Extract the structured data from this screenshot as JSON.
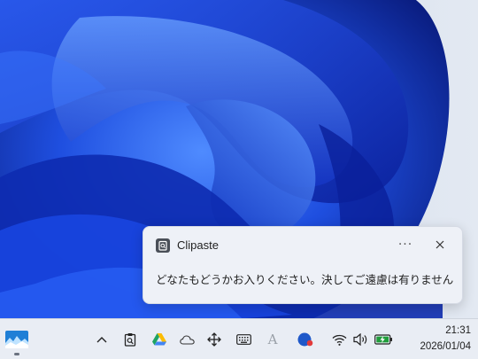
{
  "notification": {
    "app_name": "Clipaste",
    "message": "どなたもどうかお入りください。決してご遠慮は有りません",
    "more_label": "···"
  },
  "taskbar": {
    "start_icon": "landscape-app-icon",
    "tray_icons": [
      "chevron-up-icon",
      "clipboard-search-icon",
      "google-drive-icon",
      "cloud-icon",
      "move-icon",
      "keyboard-icon",
      "ime-icon",
      "blue-circle-app-icon",
      "wifi-icon",
      "volume-icon",
      "battery-charging-icon"
    ],
    "ime_label": "A",
    "time": "21:31",
    "date": "2026/01/04"
  },
  "colors": {
    "wallpaper_dark": "#0b1e8c",
    "wallpaper_bright": "#2f6bff",
    "taskbar_bg": "#e9edf4",
    "toast_bg": "#eef1f7",
    "battery_green": "#1f9d3a"
  }
}
